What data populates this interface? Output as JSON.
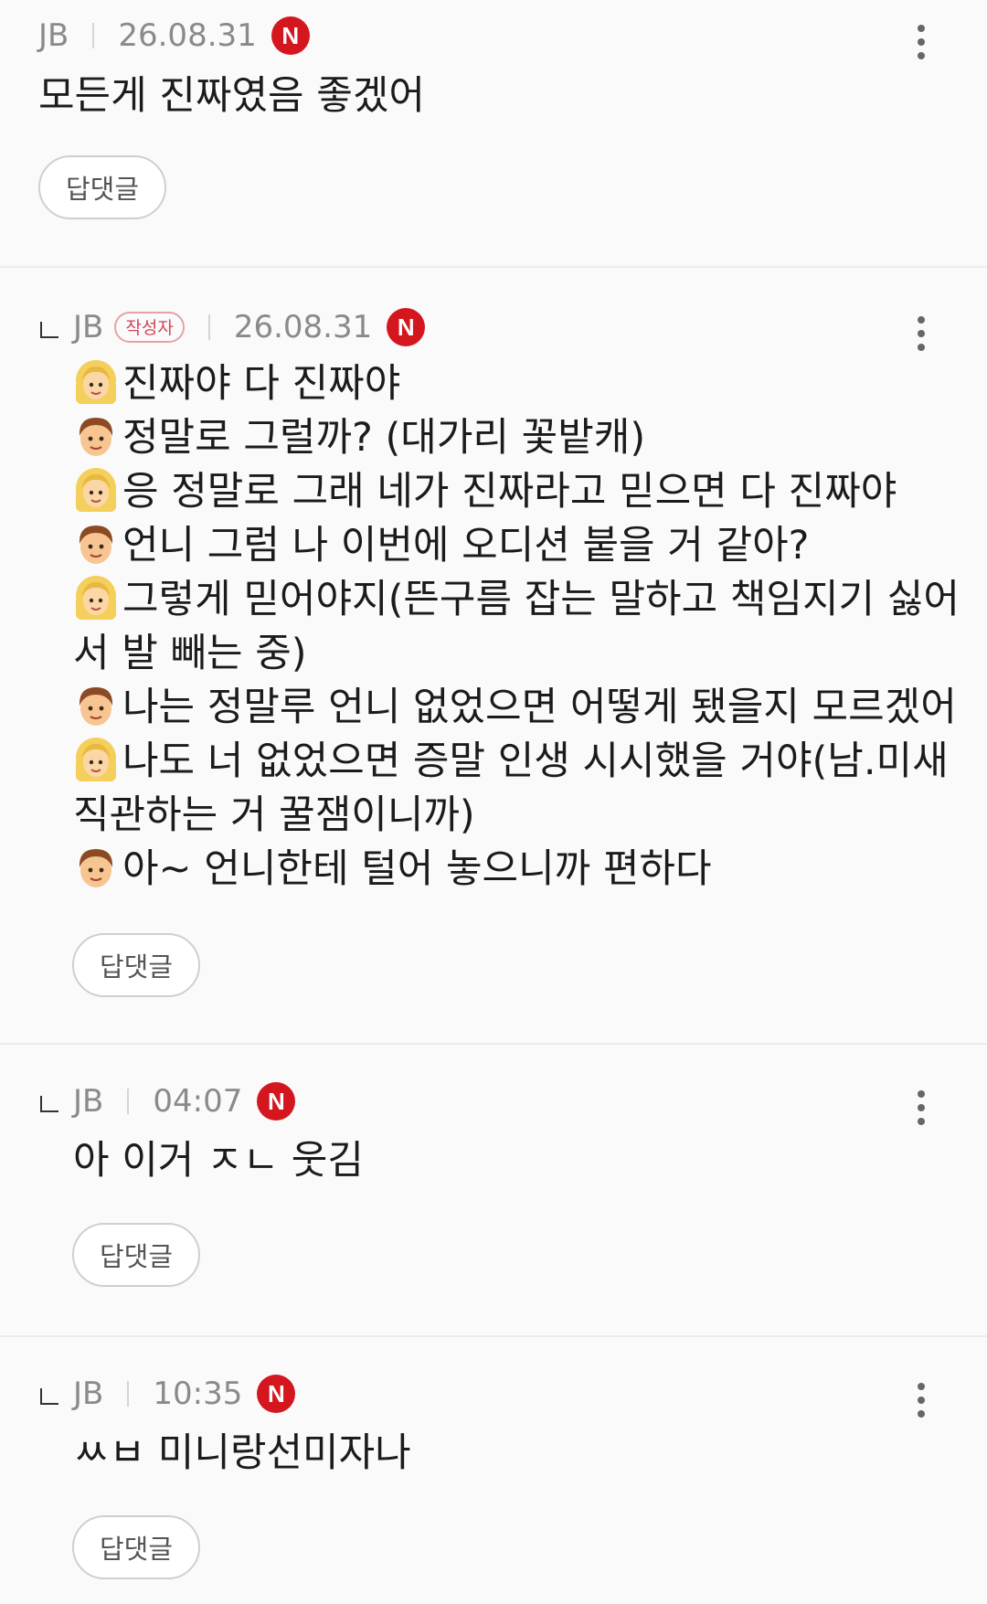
{
  "comments": [
    {
      "author": "JB",
      "date": "26.08.31",
      "new_badge": "N",
      "lines": [
        {
          "speaker": "",
          "text": "모든게 진짜였음 좋겠어"
        }
      ],
      "reply_label": "답댓글"
    },
    {
      "author": "JB",
      "author_badge": "작성자",
      "date": "26.08.31",
      "new_badge": "N",
      "lines": [
        {
          "speaker": "blonde",
          "text": "진짜야 다 진짜야"
        },
        {
          "speaker": "child",
          "text": "정말로 그럴까? (대가리 꽃밭캐)"
        },
        {
          "speaker": "blonde",
          "text": "응 정말로 그래 네가 진짜라고 믿으면 다 진짜야"
        },
        {
          "speaker": "child",
          "text": "언니 그럼 나 이번에 오디션 붙을 거 같아?"
        },
        {
          "speaker": "blonde",
          "text": "그렇게 믿어야지(뜬구름 잡는 말하고 책임지기 싫어"
        },
        {
          "speaker": "",
          "text": "서 발 빼는 중)"
        },
        {
          "speaker": "child",
          "text": "나는 정말루 언니 없었으면 어떻게 됐을지 모르겠어"
        },
        {
          "speaker": "blonde",
          "text": "나도 너 없었으면 증말 인생 시시했을 거야(남.미새"
        },
        {
          "speaker": "",
          "text": "직관하는 거 꿀잼이니까)"
        },
        {
          "speaker": "child",
          "text": "아~ 언니한테 털어 놓으니까 편하다"
        }
      ],
      "reply_label": "답댓글"
    },
    {
      "author": "JB",
      "date": "04:07",
      "new_badge": "N",
      "lines": [
        {
          "speaker": "",
          "text": "아 이거 ㅈㄴ 웃김"
        }
      ],
      "reply_label": "답댓글"
    },
    {
      "author": "JB",
      "date": "10:35",
      "new_badge": "N",
      "lines": [
        {
          "speaker": "",
          "text": "ㅆㅂ 미니랑선미자나"
        }
      ],
      "reply_label": "답댓글"
    }
  ],
  "icons": {
    "new": "n-circle-icon",
    "more": "more-vertical-icon",
    "blonde_emoji": "blonde-woman-emoji-icon",
    "child_emoji": "child-emoji-icon",
    "reply_indent": "reply-indent-icon"
  },
  "colors": {
    "new_badge": "#d4171f",
    "author_badge_text": "#d0455a",
    "meta_text": "#8a8a8a",
    "background": "#fafafa"
  }
}
